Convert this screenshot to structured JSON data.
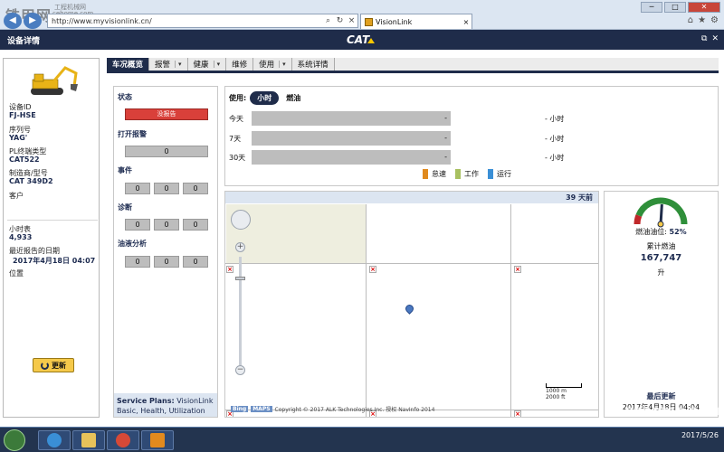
{
  "watermark": {
    "main": "铁甲网",
    "small1": "工程机械网",
    "small2": "cehome.com",
    "bottom": "cehome.com"
  },
  "browser": {
    "url": "http://www.myvisionlink.cn/",
    "tab_title": "VisionLink",
    "tab_close": "×",
    "win_min": "─",
    "win_max": "□",
    "win_close": "✕",
    "back": "◀",
    "forward": "▶",
    "search_glyph": "⌕",
    "refresh_glyph": "↻",
    "stop_glyph": "×",
    "home_glyph": "⌂",
    "star_glyph": "★",
    "gear_glyph": "⚙"
  },
  "app": {
    "title": "设备详情",
    "logo": "CAT",
    "restore_glyph": "⧉",
    "close_glyph": "✕"
  },
  "asset": {
    "id_label": "设备ID",
    "id_value": "FJ-HSE",
    "serial_label": "序列号",
    "serial_value": "YAG'",
    "pl_label": "PL终端类型",
    "pl_value": "CAT522",
    "model_label": "制造商/型号",
    "model_value": "CAT 349D2",
    "customer_label": "客户",
    "customer_value": "",
    "hours_label": "小时表",
    "hours_value": "4,933",
    "last_report_label": "最近报告的日期",
    "last_report_value": "2017年4月18日 04:07",
    "location_label": "位置",
    "location_value": "",
    "refresh_label": "更新"
  },
  "tabs": [
    {
      "label": "车况概览",
      "active": true,
      "dropdown": false
    },
    {
      "label": "报警",
      "active": false,
      "dropdown": true
    },
    {
      "label": "健康",
      "active": false,
      "dropdown": true
    },
    {
      "label": "维修",
      "active": false,
      "dropdown": false
    },
    {
      "label": "使用",
      "active": false,
      "dropdown": true
    },
    {
      "label": "系统详情",
      "active": false,
      "dropdown": false
    }
  ],
  "status": {
    "status_title": "状态",
    "status_value": "没报告",
    "open_alerts_title": "打开报警",
    "open_alerts_value": "0",
    "events_title": "事件",
    "events_values": [
      "0",
      "0",
      "0"
    ],
    "diagnostics_title": "诊断",
    "diagnostics_values": [
      "0",
      "0",
      "0"
    ],
    "fluid_title": "油液分析",
    "fluid_values": [
      "0",
      "0",
      "0"
    ],
    "service_plans_label": "Service Plans:",
    "service_plans_value": "VisionLink Basic, Health, Utilization"
  },
  "usage": {
    "label": "使用:",
    "toggle_hours": "小时",
    "toggle_fuel": "燃油",
    "rows": [
      {
        "label": "今天",
        "bar_value": "-",
        "total": "- 小时"
      },
      {
        "label": "7天",
        "bar_value": "-",
        "total": "- 小时"
      },
      {
        "label": "30天",
        "bar_value": "-",
        "total": "- 小时"
      }
    ],
    "legend": [
      {
        "label": "怠速",
        "color": "#e08a1e"
      },
      {
        "label": "工作",
        "color": "#a8c060"
      },
      {
        "label": "运行",
        "color": "#3a8fd6"
      }
    ]
  },
  "map": {
    "age": "39 天前",
    "scale_m": "1000 m",
    "scale_ft": "2000 ft",
    "attribution_badge1": "Bing",
    "attribution_badge2": "MAPS",
    "attribution": "Copyright © 2017 ALK Technologies Inc. 授权 NavInfo 2014",
    "zoom_in": "+",
    "zoom_out": "−"
  },
  "fuel": {
    "level_label": "燃油油位:",
    "level_value": "52%",
    "level_fraction": 0.52,
    "cumulative_label": "累计燃油",
    "cumulative_value": "167,747",
    "unit": "升",
    "last_update_label": "最后更新",
    "last_update_value": "2017年4月18日 04:04"
  },
  "taskbar": {
    "time": "",
    "date": "2017/5/26"
  }
}
